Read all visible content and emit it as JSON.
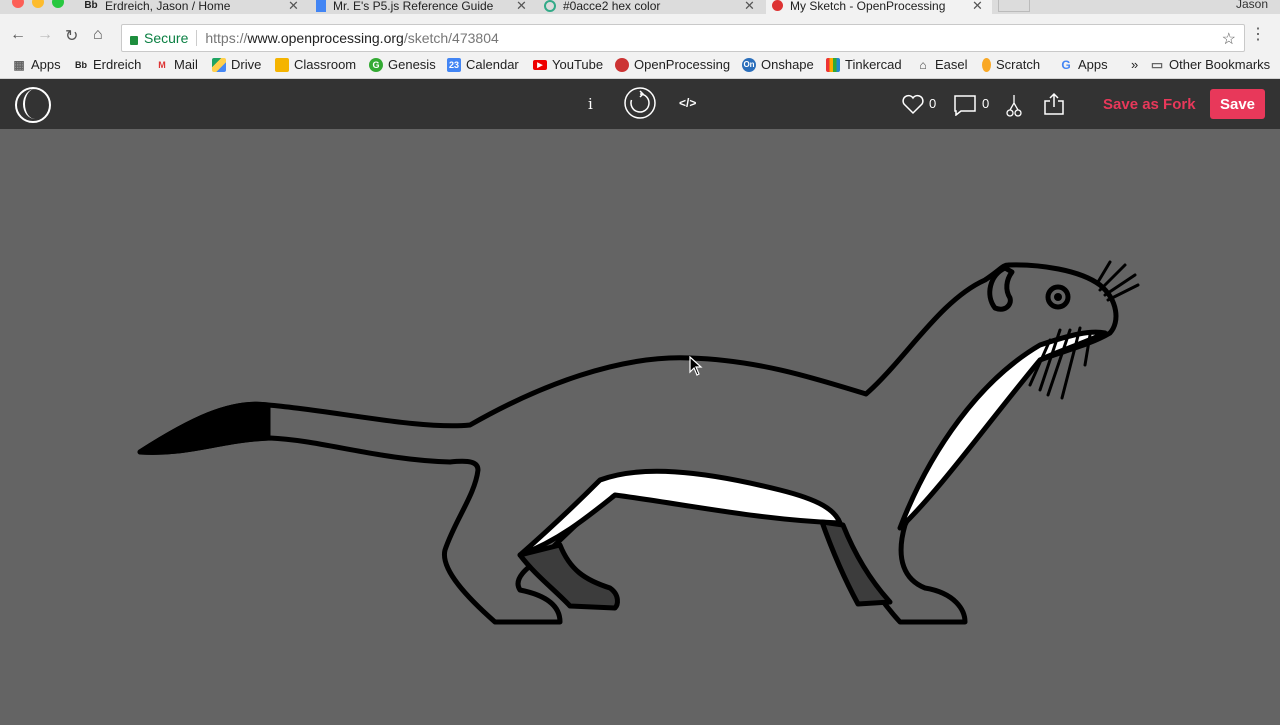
{
  "tabs": [
    {
      "favicon": "Bb",
      "title": "Erdreich, Jason / Home"
    },
    {
      "favicon": "doc-icon",
      "title": "Mr. E's P5.js Reference Guide"
    },
    {
      "favicon": "colorhex-icon",
      "title": "#0acce2 hex color"
    },
    {
      "favicon": "openprocessing-icon",
      "title": "My Sketch - OpenProcessing"
    }
  ],
  "user": "Jason",
  "address": {
    "secure_label": "Secure",
    "scheme": "https://",
    "host": "www.openprocessing.org",
    "path": "/sketch/473804"
  },
  "bookmarks": [
    {
      "label": "Apps",
      "icon": "apps-grid-icon"
    },
    {
      "label": "Erdreich",
      "icon": "Bb"
    },
    {
      "label": "Mail",
      "icon": "gmail-icon"
    },
    {
      "label": "Drive",
      "icon": "drive-icon"
    },
    {
      "label": "Classroom",
      "icon": "classroom-icon"
    },
    {
      "label": "Genesis",
      "icon": "G"
    },
    {
      "label": "Calendar",
      "icon": "23"
    },
    {
      "label": "YouTube",
      "icon": "youtube-icon"
    },
    {
      "label": "OpenProcessing",
      "icon": "openprocessing-icon"
    },
    {
      "label": "Onshape",
      "icon": "On"
    },
    {
      "label": "Tinkercad",
      "icon": "tinkercad-icon"
    },
    {
      "label": "Easel",
      "icon": "easel-icon"
    },
    {
      "label": "Scratch",
      "icon": "scratch-icon"
    },
    {
      "label": "Apps",
      "icon": "G"
    }
  ],
  "overflow": "»",
  "other_bookmarks": "Other Bookmarks",
  "op_toolbar": {
    "info": "i",
    "code": "</>",
    "likes": "0",
    "comments": "0",
    "save_as_fork": "Save as Fork",
    "save": "Save"
  },
  "colors": {
    "canvas_bg": "#646464",
    "toolbar_bg": "#333333",
    "accent": "#e8385a"
  }
}
